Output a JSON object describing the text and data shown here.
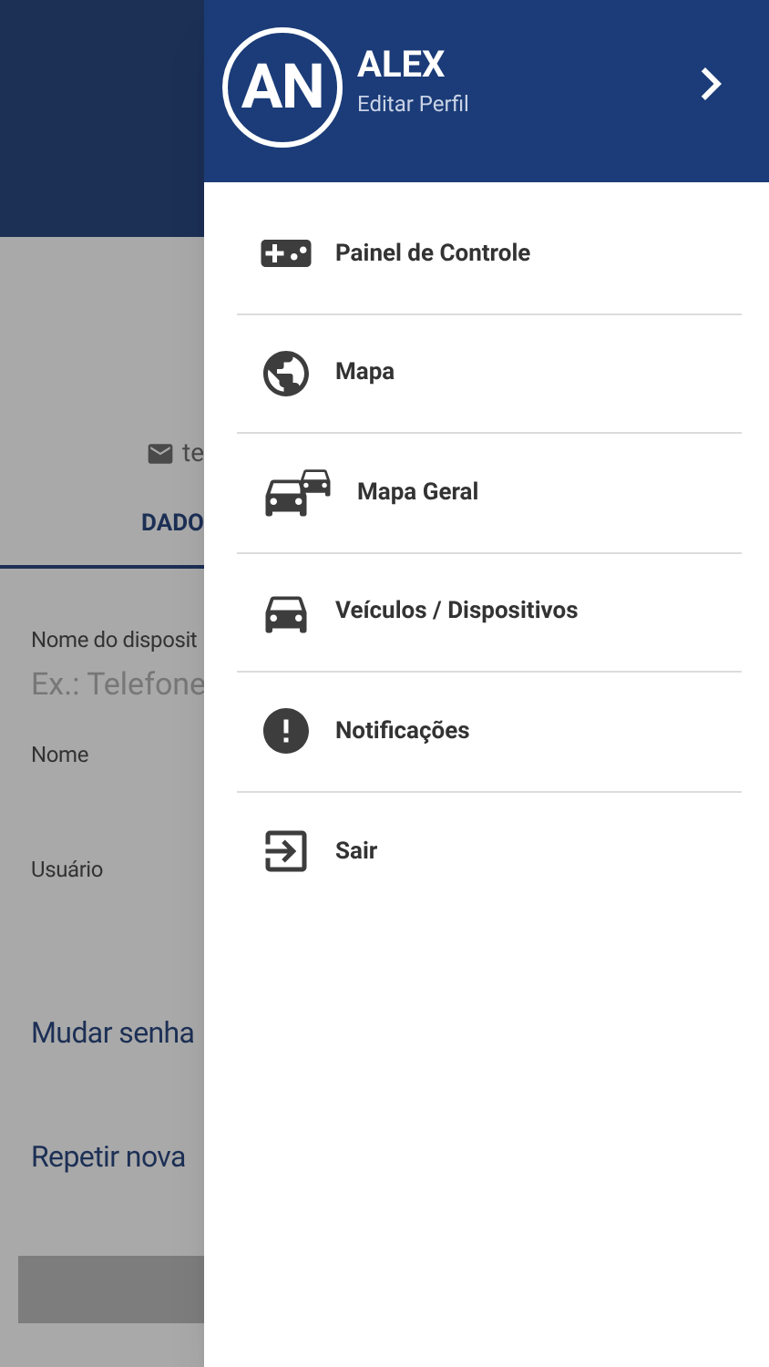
{
  "background_page": {
    "email": "te",
    "tab": "DADO",
    "fields": [
      {
        "label": "Nome do disposit",
        "placeholder": "Ex.: Telefone"
      },
      {
        "label": "Nome"
      },
      {
        "label": "Usuário"
      }
    ],
    "password_fields": [
      "Mudar senha",
      "Repetir nova"
    ]
  },
  "drawer": {
    "avatar": "AN",
    "user_name": "ALEX",
    "subtitle": "Editar Perfil",
    "items": [
      {
        "kind": "gamepad",
        "label": "Painel de Controle"
      },
      {
        "kind": "globe",
        "label": "Mapa"
      },
      {
        "kind": "cars",
        "label": "Mapa Geral"
      },
      {
        "kind": "car",
        "label": "Veículos / Dispositivos"
      },
      {
        "kind": "alert",
        "label": "Notificações"
      },
      {
        "kind": "exit",
        "label": "Sair"
      }
    ]
  }
}
